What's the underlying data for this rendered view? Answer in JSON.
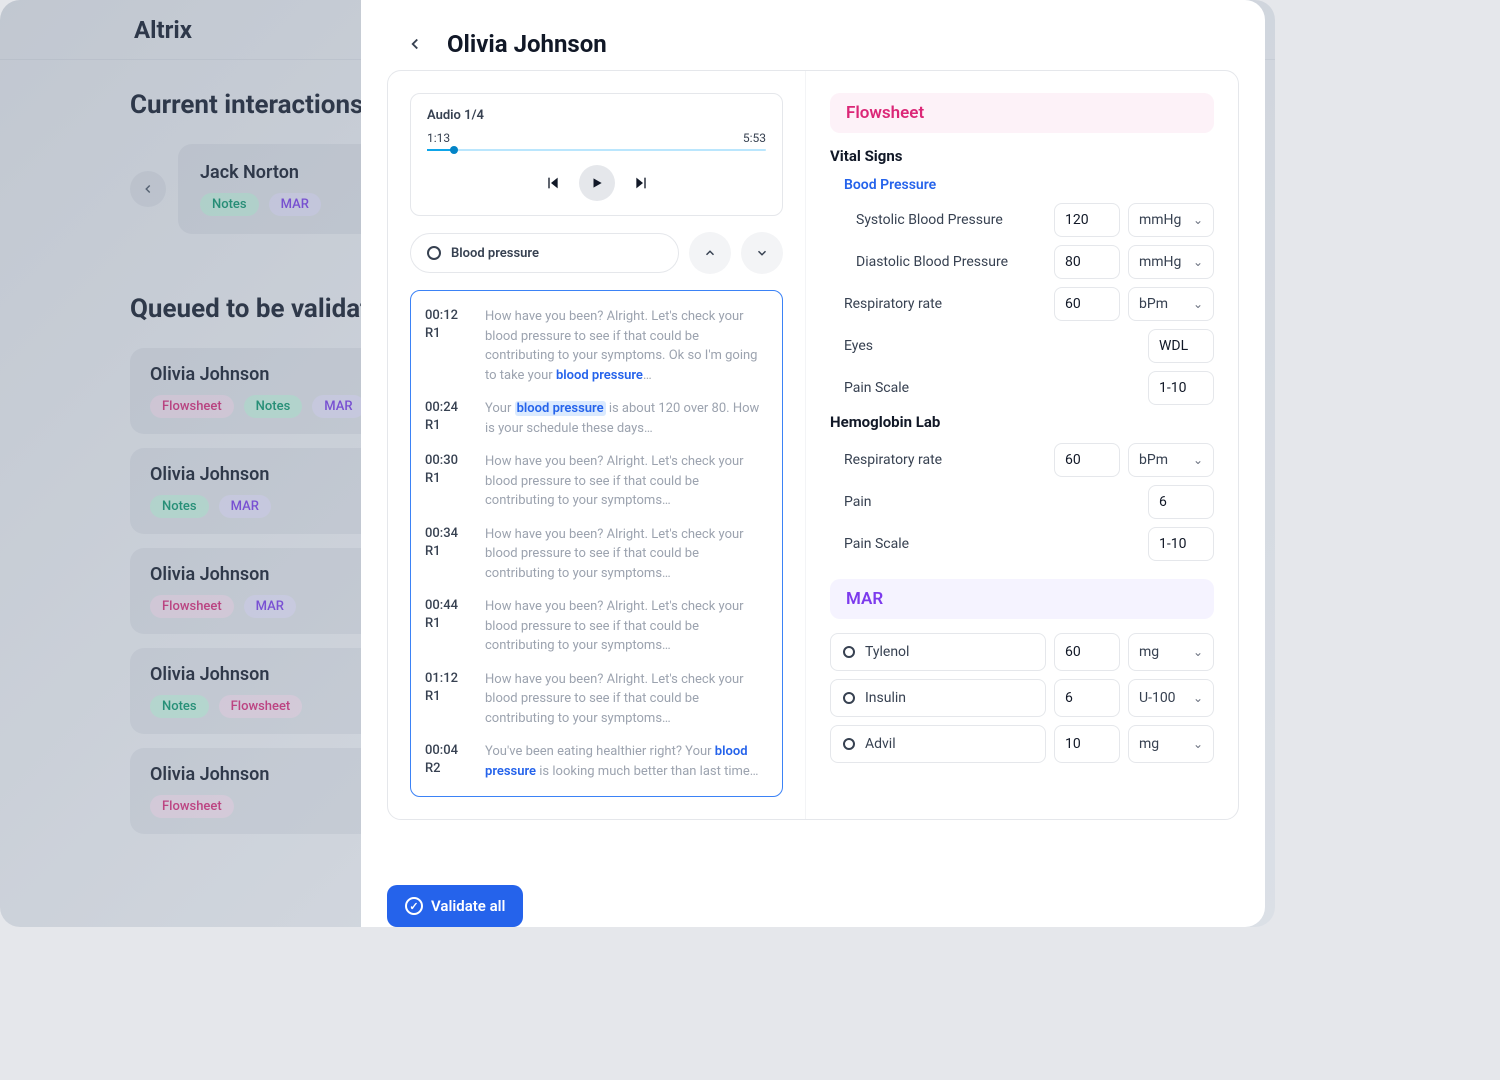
{
  "brand": "Altrix",
  "sections": {
    "current": "Current interactions",
    "queued": "Queued to be validated"
  },
  "current_patient": {
    "name": "Jack Norton",
    "tags": [
      "Notes",
      "MAR"
    ]
  },
  "queued": [
    {
      "name": "Olivia Johnson",
      "tags": [
        "Flowsheet",
        "Notes",
        "MAR"
      ]
    },
    {
      "name": "Olivia Johnson",
      "tags": [
        "Notes",
        "MAR"
      ]
    },
    {
      "name": "Olivia Johnson",
      "tags": [
        "Flowsheet",
        "MAR"
      ]
    },
    {
      "name": "Olivia Johnson",
      "tags": [
        "Notes",
        "Flowsheet"
      ]
    },
    {
      "name": "Olivia Johnson",
      "tags": [
        "Flowsheet"
      ]
    }
  ],
  "drawer": {
    "title": "Olivia Johnson",
    "audio": {
      "label": "Audio 1/4",
      "elapsed": "1:13",
      "total": "5:53"
    },
    "filter": "Blood pressure",
    "transcript": [
      {
        "time": "00:12",
        "speaker": "R1",
        "pre": "How have you been? Alright. Let's check your blood pressure to see if that could be contributing to your symptoms. Ok so I'm going to take your ",
        "kw": "blood pressure",
        "post": "…",
        "highlight": false
      },
      {
        "time": "00:24",
        "speaker": "R1",
        "pre": "Your ",
        "kw": "blood pressure",
        "post": " is about 120 over 80. How is your schedule these days…",
        "highlight": true
      },
      {
        "time": "00:30",
        "speaker": "R1",
        "pre": "How have you been? Alright. Let's check your blood pressure to see if that could be contributing to your symptoms…",
        "kw": "",
        "post": "",
        "highlight": false
      },
      {
        "time": "00:34",
        "speaker": "R1",
        "pre": "How have you been? Alright. Let's check your blood pressure to see if that could be contributing to your symptoms…",
        "kw": "",
        "post": "",
        "highlight": false
      },
      {
        "time": "00:44",
        "speaker": "R1",
        "pre": "How have you been? Alright. Let's check your blood pressure to see if that could be contributing to your symptoms…",
        "kw": "",
        "post": "",
        "highlight": false
      },
      {
        "time": "01:12",
        "speaker": "R1",
        "pre": "How have you been? Alright. Let's check your blood pressure to see if that could be contributing to your symptoms…",
        "kw": "",
        "post": "",
        "highlight": false
      },
      {
        "time": "00:04",
        "speaker": "R2",
        "pre": "You've been eating healthier right? Your ",
        "kw": "blood pressure",
        "post": " is looking much better than last time…",
        "highlight": false
      }
    ],
    "flowsheet": {
      "title": "Flowsheet",
      "vital_heading": "Vital Signs",
      "bp_heading": "Bood Pressure",
      "fields": {
        "systolic": {
          "label": "Systolic Blood Pressure",
          "value": "120",
          "unit": "mmHg"
        },
        "diastolic": {
          "label": "Diastolic Blood Pressure",
          "value": "80",
          "unit": "mmHg"
        },
        "resp": {
          "label": "Respiratory rate",
          "value": "60",
          "unit": "bPm"
        },
        "eyes": {
          "label": "Eyes",
          "value": "WDL"
        },
        "pain_scale": {
          "label": "Pain Scale",
          "value": "1-10"
        }
      },
      "hemo_heading": "Hemoglobin Lab",
      "hemo": {
        "resp": {
          "label": "Respiratory rate",
          "value": "60",
          "unit": "bPm"
        },
        "pain": {
          "label": "Pain",
          "value": "6"
        },
        "pain_scale": {
          "label": "Pain Scale",
          "value": "1-10"
        }
      }
    },
    "mar": {
      "title": "MAR",
      "meds": [
        {
          "name": "Tylenol",
          "dose": "60",
          "unit": "mg"
        },
        {
          "name": "Insulin",
          "dose": "6",
          "unit": "U-100"
        },
        {
          "name": "Advil",
          "dose": "10",
          "unit": "mg"
        }
      ]
    },
    "validate_label": "Validate all"
  }
}
